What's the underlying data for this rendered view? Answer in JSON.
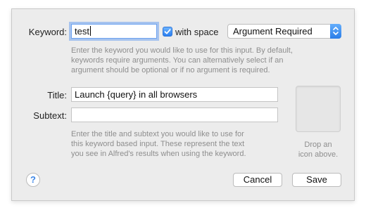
{
  "keyword": {
    "label": "Keyword:",
    "value": "test",
    "with_space_label": "with space",
    "with_space_checked": true,
    "argument_option": "Argument Required",
    "hint": "Enter the keyword you would like to use for this input. By default, keywords require arguments. You can alternatively select if an argument should be optional or if no argument is required.",
    "hint_lines": [
      "Enter the keyword you would like to use for this input. By default,",
      "keywords require arguments. You can alternatively select if an",
      "argument should be optional or if no argument is required."
    ]
  },
  "title": {
    "label": "Title:",
    "value": "Launch {query} in all browsers"
  },
  "subtext": {
    "label": "Subtext:",
    "value": ""
  },
  "title_hint_lines": [
    "Enter the title and subtext you would like to use for",
    "this keyword based input. These represent the text",
    "you see in Alfred's results when using the keyword."
  ],
  "icon_well": {
    "caption_lines": [
      "Drop an",
      "icon above."
    ]
  },
  "footer": {
    "help_label": "?",
    "cancel_label": "Cancel",
    "save_label": "Save"
  },
  "colors": {
    "accent": "#3b8cf2",
    "panel_bg": "#ececec",
    "hint_text": "#8e8e8e"
  }
}
